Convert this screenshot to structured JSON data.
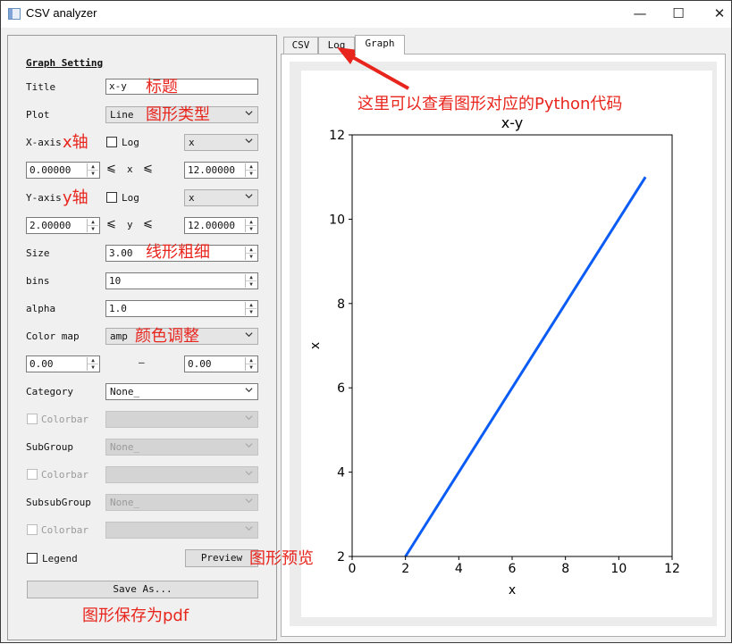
{
  "window": {
    "title": "CSV analyzer",
    "controls": {
      "minimize": "—",
      "maximize": "☐",
      "close": "✕"
    }
  },
  "graph_setting": {
    "section_title": "Graph Setting",
    "title": {
      "label": "Title",
      "value": "x-y"
    },
    "plot": {
      "label": "Plot",
      "value": "Line"
    },
    "x_axis": {
      "label": "X-axis",
      "log_label": "Log",
      "log_checked": false,
      "column": "x",
      "min": "0.00000",
      "max": "12.00000",
      "var": "x"
    },
    "y_axis": {
      "label": "Y-axis",
      "log_label": "Log",
      "log_checked": false,
      "column": "x",
      "min": "2.00000",
      "max": "12.00000",
      "var": "y"
    },
    "range_symbol": "⩽",
    "size": {
      "label": "Size",
      "value": "3.00"
    },
    "bins": {
      "label": "bins",
      "value": "10"
    },
    "alpha": {
      "label": "alpha",
      "value": "1.0"
    },
    "color_map": {
      "label": "Color map",
      "value": "amp",
      "min": "0.00",
      "max": "0.00",
      "dash": "–"
    },
    "category": {
      "label": "Category",
      "value": "None_",
      "colorbar_label": "Colorbar"
    },
    "subgroup": {
      "label": "SubGroup",
      "value": "None_",
      "colorbar_label": "Colorbar"
    },
    "subsubgroup": {
      "label": "SubsubGroup",
      "value": "None_",
      "colorbar_label": "Colorbar"
    },
    "legend": {
      "label": "Legend",
      "checked": false
    },
    "preview_button": "Preview",
    "save_button": "Save As..."
  },
  "tabs": [
    {
      "label": "CSV",
      "active": false
    },
    {
      "label": "Log",
      "active": false
    },
    {
      "label": "Graph",
      "active": true
    }
  ],
  "annotations": {
    "title": "标题",
    "plot_type": "图形类型",
    "x_axis": "x轴",
    "y_axis": "y轴",
    "line_width": "线形粗细",
    "color": "颜色调整",
    "preview": "图形预览",
    "save_pdf": "图形保存为pdf",
    "log_hint": "这里可以查看图形对应的Python代码"
  },
  "colors": {
    "annotation": "#e8251d",
    "line": "#0a5cf5"
  },
  "chart_data": {
    "type": "line",
    "title": "x-y",
    "xlabel": "x",
    "ylabel": "x",
    "xlim": [
      0,
      12
    ],
    "ylim": [
      2,
      12
    ],
    "xticks": [
      "0",
      "2",
      "4",
      "6",
      "8",
      "10",
      "12"
    ],
    "yticks": [
      "2",
      "4",
      "6",
      "8",
      "10",
      "12"
    ],
    "grid": false,
    "series": [
      {
        "x": [
          2,
          11
        ],
        "y": [
          2,
          11
        ],
        "color": "#0a5cf5",
        "linewidth": 3
      }
    ]
  }
}
